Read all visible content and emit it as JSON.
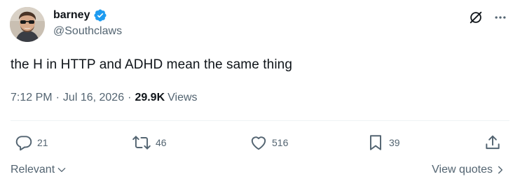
{
  "author": {
    "display_name": "barney",
    "handle": "@Southclaws",
    "verified_icon": "verified-badge-icon",
    "avatar_icon": "avatar-photo"
  },
  "tweet": {
    "text": "the H in HTTP and ADHD mean the same thing",
    "time": "7:12 PM",
    "separator": "·",
    "date": "Jul 16, 2026",
    "views_count": "29.9K",
    "views_label": "Views"
  },
  "actions": {
    "replies": "21",
    "reposts": "46",
    "likes": "516",
    "bookmarks": "39"
  },
  "footer": {
    "sort_label": "Relevant",
    "view_quotes_label": "View quotes"
  },
  "colors": {
    "text_primary": "#0f1419",
    "text_secondary": "#536471",
    "verified": "#1d9bf0",
    "divider": "#eff3f4"
  }
}
